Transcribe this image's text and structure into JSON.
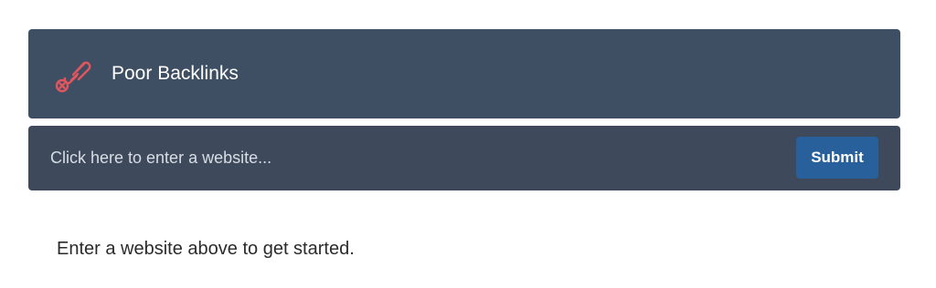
{
  "header": {
    "icon": "broken-link-icon",
    "icon_color": "#e0555e",
    "title": "Poor Backlinks",
    "background": "#3e4e63"
  },
  "search": {
    "placeholder": "Click here to enter a website...",
    "value": "",
    "submit_label": "Submit",
    "submit_color": "#27609a"
  },
  "main": {
    "helper_text": "Enter a website above to get started."
  }
}
